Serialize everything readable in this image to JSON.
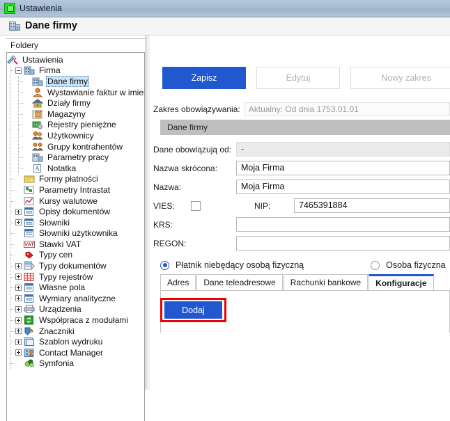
{
  "window": {
    "title": "Ustawienia",
    "title_icon": "basket-icon"
  },
  "page_header": {
    "title": "Dane firmy",
    "icon": "company-building-icon"
  },
  "sidebar": {
    "header": "Foldery",
    "items": [
      {
        "label": "Ustawienia",
        "depth": 0,
        "expander": "none",
        "icon": "tools-icon",
        "selected": false
      },
      {
        "label": "Firma",
        "depth": 1,
        "expander": "minus",
        "icon": "company-icon",
        "selected": false
      },
      {
        "label": "Dane firmy",
        "depth": 2,
        "expander": "none",
        "icon": "building-icon",
        "selected": true
      },
      {
        "label": "Wystawianie faktur w imieniu",
        "depth": 2,
        "expander": "none",
        "icon": "person-orange-icon",
        "selected": false
      },
      {
        "label": "Działy firmy",
        "depth": 2,
        "expander": "none",
        "icon": "department-icon",
        "selected": false
      },
      {
        "label": "Magazyny",
        "depth": 2,
        "expander": "none",
        "icon": "warehouse-icon",
        "selected": false
      },
      {
        "label": "Rejestry pieniężne",
        "depth": 2,
        "expander": "none",
        "icon": "money-icon",
        "selected": false
      },
      {
        "label": "Użytkownicy",
        "depth": 2,
        "expander": "none",
        "icon": "users-icon",
        "selected": false
      },
      {
        "label": "Grupy kontrahentów",
        "depth": 2,
        "expander": "none",
        "icon": "group-icon",
        "selected": false
      },
      {
        "label": "Parametry pracy",
        "depth": 2,
        "expander": "none",
        "icon": "params-icon",
        "selected": false
      },
      {
        "label": "Notatka",
        "depth": 2,
        "expander": "none",
        "icon": "note-icon",
        "selected": false
      },
      {
        "label": "Formy płatności",
        "depth": 1,
        "expander": "none",
        "icon": "payment-icon",
        "selected": false
      },
      {
        "label": "Parametry Intrastat",
        "depth": 1,
        "expander": "none",
        "icon": "intrastat-icon",
        "selected": false
      },
      {
        "label": "Kursy walutowe",
        "depth": 1,
        "expander": "none",
        "icon": "chart-icon",
        "selected": false
      },
      {
        "label": "Opisy dokumentów",
        "depth": 1,
        "expander": "plus",
        "icon": "document-blue-icon",
        "selected": false
      },
      {
        "label": "Słowniki",
        "depth": 1,
        "expander": "plus",
        "icon": "document-blue-icon",
        "selected": false
      },
      {
        "label": "Słowniki użytkownika",
        "depth": 1,
        "expander": "none",
        "icon": "document-blue-icon",
        "selected": false
      },
      {
        "label": "Stawki VAT",
        "depth": 1,
        "expander": "none",
        "icon": "vat-icon",
        "selected": false
      },
      {
        "label": "Typy cen",
        "depth": 1,
        "expander": "none",
        "icon": "price-tag-icon",
        "selected": false
      },
      {
        "label": "Typy dokumentów",
        "depth": 1,
        "expander": "plus",
        "icon": "doc-stack-icon",
        "selected": false
      },
      {
        "label": "Typy rejestrów",
        "depth": 1,
        "expander": "plus",
        "icon": "grid-red-icon",
        "selected": false
      },
      {
        "label": "Własne pola",
        "depth": 1,
        "expander": "plus",
        "icon": "document-blue-icon",
        "selected": false
      },
      {
        "label": "Wymiary analityczne",
        "depth": 1,
        "expander": "plus",
        "icon": "document-blue-icon",
        "selected": false
      },
      {
        "label": "Urządzenia",
        "depth": 1,
        "expander": "plus",
        "icon": "printer-icon",
        "selected": false
      },
      {
        "label": "Współpraca z modułami",
        "depth": 1,
        "expander": "plus",
        "icon": "sync-green-icon",
        "selected": false
      },
      {
        "label": "Znaczniki",
        "depth": 1,
        "expander": "plus",
        "icon": "tag-icon",
        "selected": false
      },
      {
        "label": "Szablon wydruku",
        "depth": 1,
        "expander": "plus",
        "icon": "print-template-icon",
        "selected": false
      },
      {
        "label": "Contact Manager",
        "depth": 1,
        "expander": "plus",
        "icon": "contact-icon",
        "selected": false
      },
      {
        "label": "Symfonia",
        "depth": 1,
        "expander": "none",
        "icon": "symfonia-icon",
        "selected": false
      }
    ]
  },
  "main": {
    "toolbar": {
      "save_label": "Zapisz",
      "edit_label": "Edytuj",
      "new_range_label": "Nowy zakres"
    },
    "scope": {
      "label": "Zakres obowiązywania:",
      "value": "Aktualny: Od dnia 1753.01.01"
    },
    "section_title": "Dane firmy",
    "fields": [
      {
        "label": "Dane obowiązują od:",
        "value": "-",
        "readonly": true
      },
      {
        "label": "Nazwa skrócona:",
        "value": "Moja Firma",
        "readonly": false
      },
      {
        "label": "Nazwa:",
        "value": "Moja Firma",
        "readonly": false
      }
    ],
    "vies": {
      "label": "VIES:",
      "checked": false,
      "nip_label": "NIP:",
      "nip_value": "7465391884"
    },
    "krs": {
      "label": "KRS:",
      "value": ""
    },
    "regon": {
      "label": "REGON:",
      "value": ""
    },
    "taxpayer_type": {
      "option_legal": "Płatnik niebędący osobą fizyczną",
      "option_natural": "Osoba fizyczna",
      "selected": "legal"
    },
    "tabs": [
      {
        "label": "Adres",
        "active": false
      },
      {
        "label": "Dane teleadresowe",
        "active": false
      },
      {
        "label": "Rachunki bankowe",
        "active": false
      },
      {
        "label": "Konfiguracje",
        "active": true
      }
    ],
    "add_button_label": "Dodaj"
  },
  "colors": {
    "accent_blue": "#2158cf",
    "highlight_red": "#f00000",
    "section_gray": "#bfbfbf",
    "titlebar_blue": "#a8bcd2",
    "selection_blue": "#cce4f7"
  }
}
